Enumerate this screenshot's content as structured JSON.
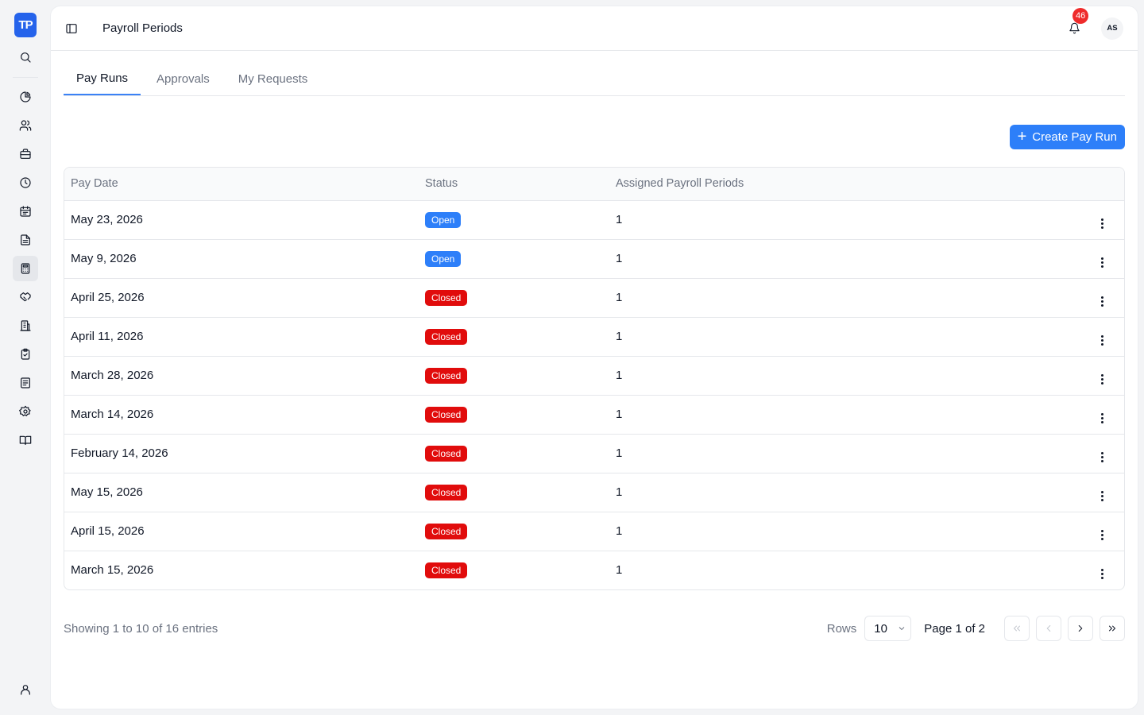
{
  "brand": {
    "logo_text": "TP"
  },
  "header": {
    "title": "Payroll Periods",
    "notification_count": "46",
    "avatar_initials": "AS"
  },
  "tabs": [
    {
      "label": "Pay Runs",
      "active": true
    },
    {
      "label": "Approvals",
      "active": false
    },
    {
      "label": "My Requests",
      "active": false
    }
  ],
  "actions": {
    "create_label": "Create Pay Run"
  },
  "table": {
    "columns": [
      "Pay Date",
      "Status",
      "Assigned Payroll Periods"
    ],
    "rows": [
      {
        "pay_date": "May 23, 2026",
        "status": "Open",
        "periods": "1"
      },
      {
        "pay_date": "May 9, 2026",
        "status": "Open",
        "periods": "1"
      },
      {
        "pay_date": "April 25, 2026",
        "status": "Closed",
        "periods": "1"
      },
      {
        "pay_date": "April 11, 2026",
        "status": "Closed",
        "periods": "1"
      },
      {
        "pay_date": "March 28, 2026",
        "status": "Closed",
        "periods": "1"
      },
      {
        "pay_date": "March 14, 2026",
        "status": "Closed",
        "periods": "1"
      },
      {
        "pay_date": "February 14, 2026",
        "status": "Closed",
        "periods": "1"
      },
      {
        "pay_date": "May 15, 2026",
        "status": "Closed",
        "periods": "1"
      },
      {
        "pay_date": "April 15, 2026",
        "status": "Closed",
        "periods": "1"
      },
      {
        "pay_date": "March 15, 2026",
        "status": "Closed",
        "periods": "1"
      }
    ]
  },
  "footer": {
    "showing": "Showing 1 to 10 of 16 entries",
    "rows_label": "Rows",
    "rows_value": "10",
    "page_info": "Page 1 of 2"
  },
  "colors": {
    "accent": "#2d7ff9",
    "closed": "#e10c0c",
    "notification": "#ef2b2b"
  },
  "sidebar_icons": [
    "search-icon",
    "dashboard-icon",
    "people-icon",
    "briefcase-icon",
    "clock-icon",
    "calendar-icon",
    "document-icon",
    "calculator-icon",
    "handshake-icon",
    "building-icon",
    "clipboard-check-icon",
    "list-doc-icon",
    "settings-icon",
    "book-icon",
    "user-icon"
  ]
}
